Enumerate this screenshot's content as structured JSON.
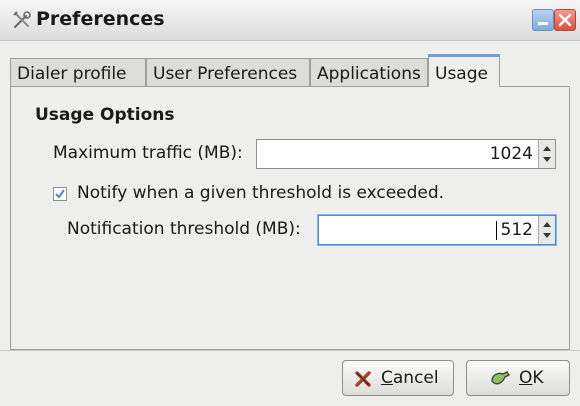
{
  "window": {
    "title": "Preferences",
    "app_icon": "tools-icon"
  },
  "tabs": [
    {
      "label": "Dialer profile",
      "active": false
    },
    {
      "label": "User Preferences",
      "active": false
    },
    {
      "label": "Applications",
      "active": false
    },
    {
      "label": "Usage",
      "active": true
    }
  ],
  "usage": {
    "section_title": "Usage Options",
    "max_traffic_label": "Maximum traffic (MB):",
    "max_traffic_value": "1024",
    "notify_label": "Notify when a given threshold is exceeded.",
    "notify_checked": true,
    "threshold_label": "Notification threshold (MB):",
    "threshold_value": "512"
  },
  "buttons": {
    "cancel_mnemonic": "C",
    "cancel_rest": "ancel",
    "ok_mnemonic": "O",
    "ok_rest": "K"
  },
  "colors": {
    "accent": "#6aa2d8",
    "close": "#d9533e",
    "minimize": "#7ea9dc"
  }
}
